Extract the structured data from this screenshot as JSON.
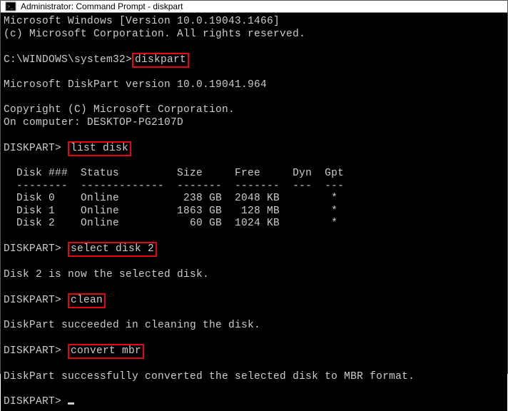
{
  "window": {
    "title": "Administrator: Command Prompt - diskpart"
  },
  "t": {
    "winver": "Microsoft Windows [Version 10.0.19043.1466]",
    "copyright": "(c) Microsoft Corporation. All rights reserved.",
    "prompt_path": "C:\\WINDOWS\\system32>",
    "cmd_diskpart": "diskpart",
    "dpver": "Microsoft DiskPart version 10.0.19041.964",
    "dpcopy": "Copyright (C) Microsoft Corporation.",
    "oncomp": "On computer: DESKTOP-PG2107D",
    "dp_prompt": "DISKPART>",
    "cmd_list": "list disk",
    "hdr": "  Disk ###  Status         Size     Free     Dyn  Gpt",
    "sep": "  --------  -------------  -------  -------  ---  ---",
    "row0": "  Disk 0    Online          238 GB  2048 KB        *",
    "row1": "  Disk 1    Online         1863 GB   128 MB        *",
    "row2": "  Disk 2    Online           60 GB  1024 KB        *",
    "cmd_select": "select disk 2",
    "res_select": "Disk 2 is now the selected disk.",
    "cmd_clean": "clean",
    "res_clean": "DiskPart succeeded in cleaning the disk.",
    "cmd_convert": "convert mbr",
    "res_convert": "DiskPart successfully converted the selected disk to MBR format."
  },
  "disk_table": {
    "columns": [
      "Disk ###",
      "Status",
      "Size",
      "Free",
      "Dyn",
      "Gpt"
    ],
    "rows": [
      {
        "disk": "Disk 0",
        "status": "Online",
        "size": "238 GB",
        "free": "2048 KB",
        "dyn": "",
        "gpt": "*"
      },
      {
        "disk": "Disk 1",
        "status": "Online",
        "size": "1863 GB",
        "free": "128 MB",
        "dyn": "",
        "gpt": "*"
      },
      {
        "disk": "Disk 2",
        "status": "Online",
        "size": "60 GB",
        "free": "1024 KB",
        "dyn": "",
        "gpt": "*"
      }
    ]
  }
}
